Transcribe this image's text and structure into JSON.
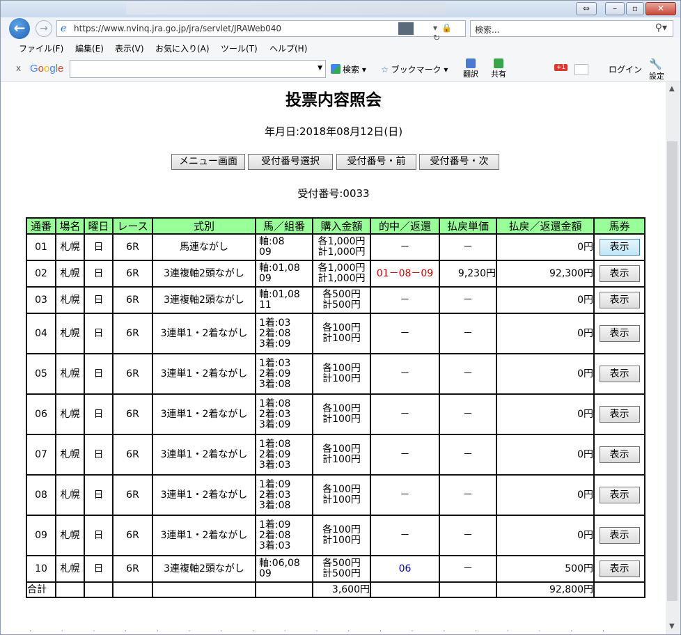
{
  "browser": {
    "url": "https://www.nvinq.jra.go.jp/jra/servlet/JRAWeb040",
    "search_placeholder": "検索...",
    "menu": [
      "ファイル(F)",
      "編集(E)",
      "表示(V)",
      "お気に入り(A)",
      "ツール(T)",
      "ヘルプ(H)"
    ],
    "google_bar": {
      "close": "x",
      "logo": "Google",
      "search": "検索",
      "bookmark": "ブックマーク",
      "translate": "翻訳",
      "share": "共有",
      "gplus": "+1",
      "login": "ログイン",
      "settings": "設定"
    }
  },
  "page": {
    "title": "投票内容照会",
    "date_label": "年月日:2018年08月12日(日)",
    "buttons": [
      "メニュー画面",
      "受付番号選択",
      "受付番号・前",
      "受付番号・次"
    ],
    "receipt": "受付番号:0033"
  },
  "table": {
    "headers": [
      "通番",
      "場名",
      "曜日",
      "レース",
      "式別",
      "馬／組番",
      "購入金額",
      "的中／返還",
      "払戻単価",
      "払戻／返還金額",
      "馬券"
    ],
    "rows": [
      {
        "no": "01",
        "place": "札幌",
        "day": "日",
        "race": "6R",
        "type": "馬連ながし",
        "combo": [
          "軸:08",
          "09"
        ],
        "amount": [
          "各1,000円",
          "計1,000円"
        ],
        "hit": "－",
        "unit": "－",
        "payout": "0円",
        "ticket": "表示"
      },
      {
        "no": "02",
        "place": "札幌",
        "day": "日",
        "race": "6R",
        "type": "3連複軸2頭ながし",
        "combo": [
          "軸:01,08",
          "09"
        ],
        "amount": [
          "各1,000円",
          "計1,000円"
        ],
        "hit": "01－08－09",
        "unit": "9,230円",
        "payout": "92,300円",
        "ticket": "表示"
      },
      {
        "no": "03",
        "place": "札幌",
        "day": "日",
        "race": "6R",
        "type": "3連複軸2頭ながし",
        "combo": [
          "軸:01,08",
          "11"
        ],
        "amount": [
          "各500円",
          "計500円"
        ],
        "hit": "－",
        "unit": "－",
        "payout": "0円",
        "ticket": "表示"
      },
      {
        "no": "04",
        "place": "札幌",
        "day": "日",
        "race": "6R",
        "type": "3連単1・2着ながし",
        "combo": [
          "1着:03",
          "2着:08",
          "3着:09"
        ],
        "amount": [
          "各100円",
          "計100円"
        ],
        "hit": "－",
        "unit": "－",
        "payout": "0円",
        "ticket": "表示"
      },
      {
        "no": "05",
        "place": "札幌",
        "day": "日",
        "race": "6R",
        "type": "3連単1・2着ながし",
        "combo": [
          "1着:03",
          "2着:09",
          "3着:08"
        ],
        "amount": [
          "各100円",
          "計100円"
        ],
        "hit": "－",
        "unit": "－",
        "payout": "0円",
        "ticket": "表示"
      },
      {
        "no": "06",
        "place": "札幌",
        "day": "日",
        "race": "6R",
        "type": "3連単1・2着ながし",
        "combo": [
          "1着:08",
          "2着:03",
          "3着:09"
        ],
        "amount": [
          "各100円",
          "計100円"
        ],
        "hit": "－",
        "unit": "－",
        "payout": "0円",
        "ticket": "表示"
      },
      {
        "no": "07",
        "place": "札幌",
        "day": "日",
        "race": "6R",
        "type": "3連単1・2着ながし",
        "combo": [
          "1着:08",
          "2着:09",
          "3着:03"
        ],
        "amount": [
          "各100円",
          "計100円"
        ],
        "hit": "－",
        "unit": "－",
        "payout": "0円",
        "ticket": "表示"
      },
      {
        "no": "08",
        "place": "札幌",
        "day": "日",
        "race": "6R",
        "type": "3連単1・2着ながし",
        "combo": [
          "1着:09",
          "2着:03",
          "3着:08"
        ],
        "amount": [
          "各100円",
          "計100円"
        ],
        "hit": "－",
        "unit": "－",
        "payout": "0円",
        "ticket": "表示"
      },
      {
        "no": "09",
        "place": "札幌",
        "day": "日",
        "race": "6R",
        "type": "3連単1・2着ながし",
        "combo": [
          "1着:09",
          "2着:08",
          "3着:03"
        ],
        "amount": [
          "各100円",
          "計100円"
        ],
        "hit": "－",
        "unit": "－",
        "payout": "0円",
        "ticket": "表示"
      },
      {
        "no": "10",
        "place": "札幌",
        "day": "日",
        "race": "6R",
        "type": "3連複軸2頭ながし",
        "combo": [
          "軸:06,08",
          "09"
        ],
        "amount": [
          "各500円",
          "計500円"
        ],
        "hit": "06",
        "unit": "－",
        "payout": "500円",
        "ticket": "表示"
      }
    ],
    "total": {
      "label": "合計",
      "amount": "3,600円",
      "payout": "92,800円"
    }
  },
  "colors": {
    "header_bg": "#99ff99",
    "hit_red": "#cc0000",
    "refund_blue": "#0000aa"
  }
}
